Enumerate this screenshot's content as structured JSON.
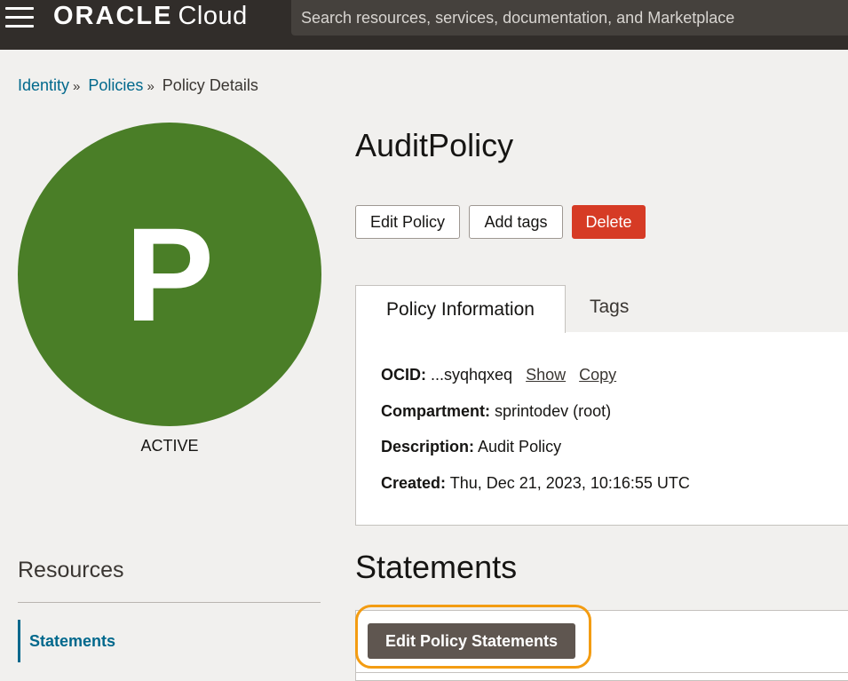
{
  "header": {
    "brand_oracle": "ORACLE",
    "brand_cloud": "Cloud",
    "search_placeholder": "Search resources, services, documentation, and Marketplace"
  },
  "breadcrumb": {
    "items": [
      "Identity",
      "Policies",
      "Policy Details"
    ],
    "separator": "»"
  },
  "avatar": {
    "letter": "P",
    "status": "ACTIVE",
    "color": "#4a7e27"
  },
  "policy": {
    "title": "AuditPolicy",
    "actions": {
      "edit": "Edit Policy",
      "add_tags": "Add tags",
      "delete": "Delete"
    }
  },
  "tabs": {
    "active": "Policy Information",
    "inactive": "Tags"
  },
  "info": {
    "ocid_label": "OCID:",
    "ocid_value": "...syqhqxeq",
    "show": "Show",
    "copy": "Copy",
    "compartment_label": "Compartment:",
    "compartment_value": "sprintodev (root)",
    "description_label": "Description:",
    "description_value": "Audit Policy",
    "created_label": "Created:",
    "created_value": "Thu, Dec 21, 2023, 10:16:55 UTC"
  },
  "resources": {
    "title": "Resources",
    "items": [
      "Statements"
    ]
  },
  "statements": {
    "title": "Statements",
    "edit_button": "Edit Policy Statements"
  },
  "colors": {
    "accent": "#00688c",
    "delete": "#d63b25",
    "highlight": "#f39c12",
    "topbar": "#312d2a"
  }
}
